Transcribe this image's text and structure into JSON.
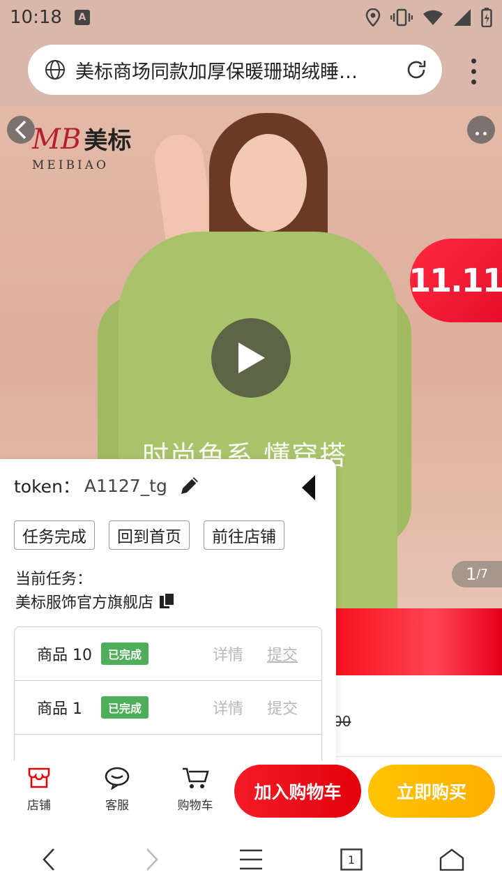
{
  "status_bar": {
    "time": "10:18",
    "app_icon_letter": "A"
  },
  "browser": {
    "page_title": "美标商场同款加厚保暖珊瑚绒睡…",
    "icons": {
      "site": "globe-icon",
      "reload": "reload-icon",
      "menu": "more-vert-icon"
    }
  },
  "hero": {
    "brand_mark": "MB",
    "brand_cn": "美标",
    "brand_en": "MEIBIAO",
    "caption": "时尚色系 懂穿搭",
    "counter_current": "1",
    "counter_total": "/7",
    "badge": "11.11"
  },
  "product": {
    "strike_price_tail": "00"
  },
  "panel": {
    "token_label": "token：",
    "token_value": "A1127_tg",
    "buttons": {
      "task_done": "任务完成",
      "back_home": "回到首页",
      "goto_shop": "前往店铺"
    },
    "current_task_label": "当前任务：",
    "current_task_name": "美标服饰官方旗舰店",
    "rows": [
      {
        "name": "商品 10",
        "status": "已完成",
        "detail": "详情",
        "submit": "提交"
      },
      {
        "name": "商品 1",
        "status": "已完成",
        "detail": "详情",
        "submit": "提交"
      }
    ]
  },
  "action_bar": {
    "shop": "店铺",
    "service": "客服",
    "cart": "购物车",
    "add_to_cart": "加入购物车",
    "buy_now": "立即购买"
  },
  "nav": {
    "tab_count": "1"
  },
  "colors": {
    "accent_red": "#E3000B",
    "accent_yellow": "#FFB300",
    "status_green": "#4FAE5A"
  }
}
